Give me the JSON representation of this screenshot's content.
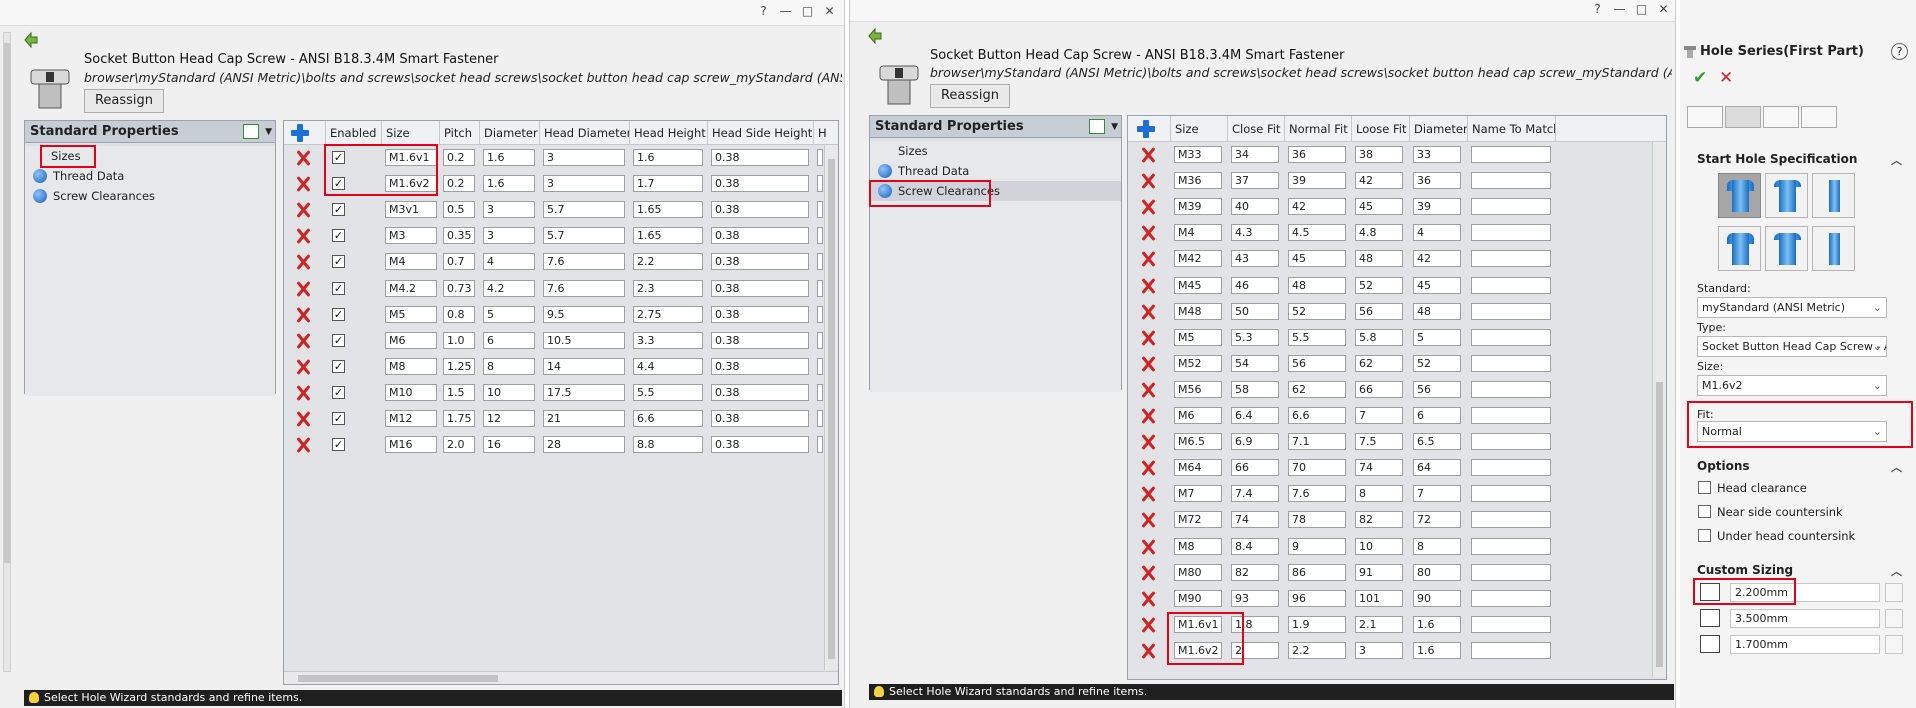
{
  "title_bar_controls": [
    "?",
    "—",
    "□",
    "✕"
  ],
  "window1": {
    "fastener_title": "Socket Button Head Cap Screw - ANSI B18.3.4M Smart Fastener",
    "file_path": "browser\\myStandard (ANSI Metric)\\bolts and screws\\socket head screws\\socket button head cap screw_myStandard (ANSI Metric).sldprt",
    "reassign_label": "Reassign",
    "panel_title": "Standard Properties",
    "tree_items": [
      "Sizes",
      "Thread Data",
      "Screw Clearances"
    ],
    "columns": [
      "Enabled",
      "Size",
      "Pitch",
      "Diameter",
      "Head Diameter",
      "Head Height",
      "Head Side Height",
      "H"
    ],
    "rows": [
      {
        "enabled": true,
        "size": "M1.6v1",
        "pitch": "0.2",
        "diameter": "1.6",
        "head_diameter": "3",
        "head_height": "1.6",
        "head_side_height": "0.38"
      },
      {
        "enabled": true,
        "size": "M1.6v2",
        "pitch": "0.2",
        "diameter": "1.6",
        "head_diameter": "3",
        "head_height": "1.7",
        "head_side_height": "0.38"
      },
      {
        "enabled": true,
        "size": "M3v1",
        "pitch": "0.5",
        "diameter": "3",
        "head_diameter": "5.7",
        "head_height": "1.65",
        "head_side_height": "0.38"
      },
      {
        "enabled": true,
        "size": "M3",
        "pitch": "0.35",
        "diameter": "3",
        "head_diameter": "5.7",
        "head_height": "1.65",
        "head_side_height": "0.38"
      },
      {
        "enabled": true,
        "size": "M4",
        "pitch": "0.7",
        "diameter": "4",
        "head_diameter": "7.6",
        "head_height": "2.2",
        "head_side_height": "0.38"
      },
      {
        "enabled": true,
        "size": "M4.2",
        "pitch": "0.73",
        "diameter": "4.2",
        "head_diameter": "7.6",
        "head_height": "2.3",
        "head_side_height": "0.38"
      },
      {
        "enabled": true,
        "size": "M5",
        "pitch": "0.8",
        "diameter": "5",
        "head_diameter": "9.5",
        "head_height": "2.75",
        "head_side_height": "0.38"
      },
      {
        "enabled": true,
        "size": "M6",
        "pitch": "1.0",
        "diameter": "6",
        "head_diameter": "10.5",
        "head_height": "3.3",
        "head_side_height": "0.38"
      },
      {
        "enabled": true,
        "size": "M8",
        "pitch": "1.25",
        "diameter": "8",
        "head_diameter": "14",
        "head_height": "4.4",
        "head_side_height": "0.38"
      },
      {
        "enabled": true,
        "size": "M10",
        "pitch": "1.5",
        "diameter": "10",
        "head_diameter": "17.5",
        "head_height": "5.5",
        "head_side_height": "0.38"
      },
      {
        "enabled": true,
        "size": "M12",
        "pitch": "1.75",
        "diameter": "12",
        "head_diameter": "21",
        "head_height": "6.6",
        "head_side_height": "0.38"
      },
      {
        "enabled": true,
        "size": "M16",
        "pitch": "2.0",
        "diameter": "16",
        "head_diameter": "28",
        "head_height": "8.8",
        "head_side_height": "0.38"
      }
    ],
    "status": "Select Hole Wizard standards and refine items."
  },
  "window2": {
    "fastener_title": "Socket Button Head Cap Screw - ANSI B18.3.4M Smart Fastener",
    "file_path": "browser\\myStandard (ANSI Metric)\\bolts and screws\\socket head screws\\socket button head cap screw_myStandard (ANSI Metric).sldprt",
    "reassign_label": "Reassign",
    "panel_title": "Standard Properties",
    "tree_items": [
      "Sizes",
      "Thread Data",
      "Screw Clearances"
    ],
    "columns": [
      "Size",
      "Close Fit",
      "Normal Fit",
      "Loose Fit",
      "Diameter",
      "Name To Match"
    ],
    "rows": [
      {
        "size": "M33",
        "close": "34",
        "normal": "36",
        "loose": "38",
        "diameter": "33"
      },
      {
        "size": "M36",
        "close": "37",
        "normal": "39",
        "loose": "42",
        "diameter": "36"
      },
      {
        "size": "M39",
        "close": "40",
        "normal": "42",
        "loose": "45",
        "diameter": "39"
      },
      {
        "size": "M4",
        "close": "4.3",
        "normal": "4.5",
        "loose": "4.8",
        "diameter": "4"
      },
      {
        "size": "M42",
        "close": "43",
        "normal": "45",
        "loose": "48",
        "diameter": "42"
      },
      {
        "size": "M45",
        "close": "46",
        "normal": "48",
        "loose": "52",
        "diameter": "45"
      },
      {
        "size": "M48",
        "close": "50",
        "normal": "52",
        "loose": "56",
        "diameter": "48"
      },
      {
        "size": "M5",
        "close": "5.3",
        "normal": "5.5",
        "loose": "5.8",
        "diameter": "5"
      },
      {
        "size": "M52",
        "close": "54",
        "normal": "56",
        "loose": "62",
        "diameter": "52"
      },
      {
        "size": "M56",
        "close": "58",
        "normal": "62",
        "loose": "66",
        "diameter": "56"
      },
      {
        "size": "M6",
        "close": "6.4",
        "normal": "6.6",
        "loose": "7",
        "diameter": "6"
      },
      {
        "size": "M6.5",
        "close": "6.9",
        "normal": "7.1",
        "loose": "7.5",
        "diameter": "6.5"
      },
      {
        "size": "M64",
        "close": "66",
        "normal": "70",
        "loose": "74",
        "diameter": "64"
      },
      {
        "size": "M7",
        "close": "7.4",
        "normal": "7.6",
        "loose": "8",
        "diameter": "7"
      },
      {
        "size": "M72",
        "close": "74",
        "normal": "78",
        "loose": "82",
        "diameter": "72"
      },
      {
        "size": "M8",
        "close": "8.4",
        "normal": "9",
        "loose": "10",
        "diameter": "8"
      },
      {
        "size": "M80",
        "close": "82",
        "normal": "86",
        "loose": "91",
        "diameter": "80"
      },
      {
        "size": "M90",
        "close": "93",
        "normal": "96",
        "loose": "101",
        "diameter": "90"
      },
      {
        "size": "M1.6v1",
        "close": "1.8",
        "normal": "1.9",
        "loose": "2.1",
        "diameter": "1.6"
      },
      {
        "size": "M1.6v2",
        "close": "2",
        "normal": "2.2",
        "loose": "3",
        "diameter": "1.6"
      }
    ],
    "status": "Select Hole Wizard standards and refine items."
  },
  "property_manager": {
    "title": "Hole Series(First Part)",
    "help": "?",
    "ok_symbol": "✔",
    "cancel_symbol": "✕",
    "start_hole_spec": "Start Hole Specification",
    "standard_label": "Standard:",
    "standard_value": "myStandard (ANSI Metric)",
    "type_label": "Type:",
    "type_value": "Socket Button Head Cap Screw - AN",
    "size_label": "Size:",
    "size_value": "M1.6v2",
    "fit_label": "Fit:",
    "fit_value": "Normal",
    "options_title": "Options",
    "options": [
      "Head clearance",
      "Near side countersink",
      "Under head countersink"
    ],
    "custom_sizing_title": "Custom Sizing",
    "custom_values": [
      "2.200mm",
      "3.500mm",
      "1.700mm"
    ]
  }
}
